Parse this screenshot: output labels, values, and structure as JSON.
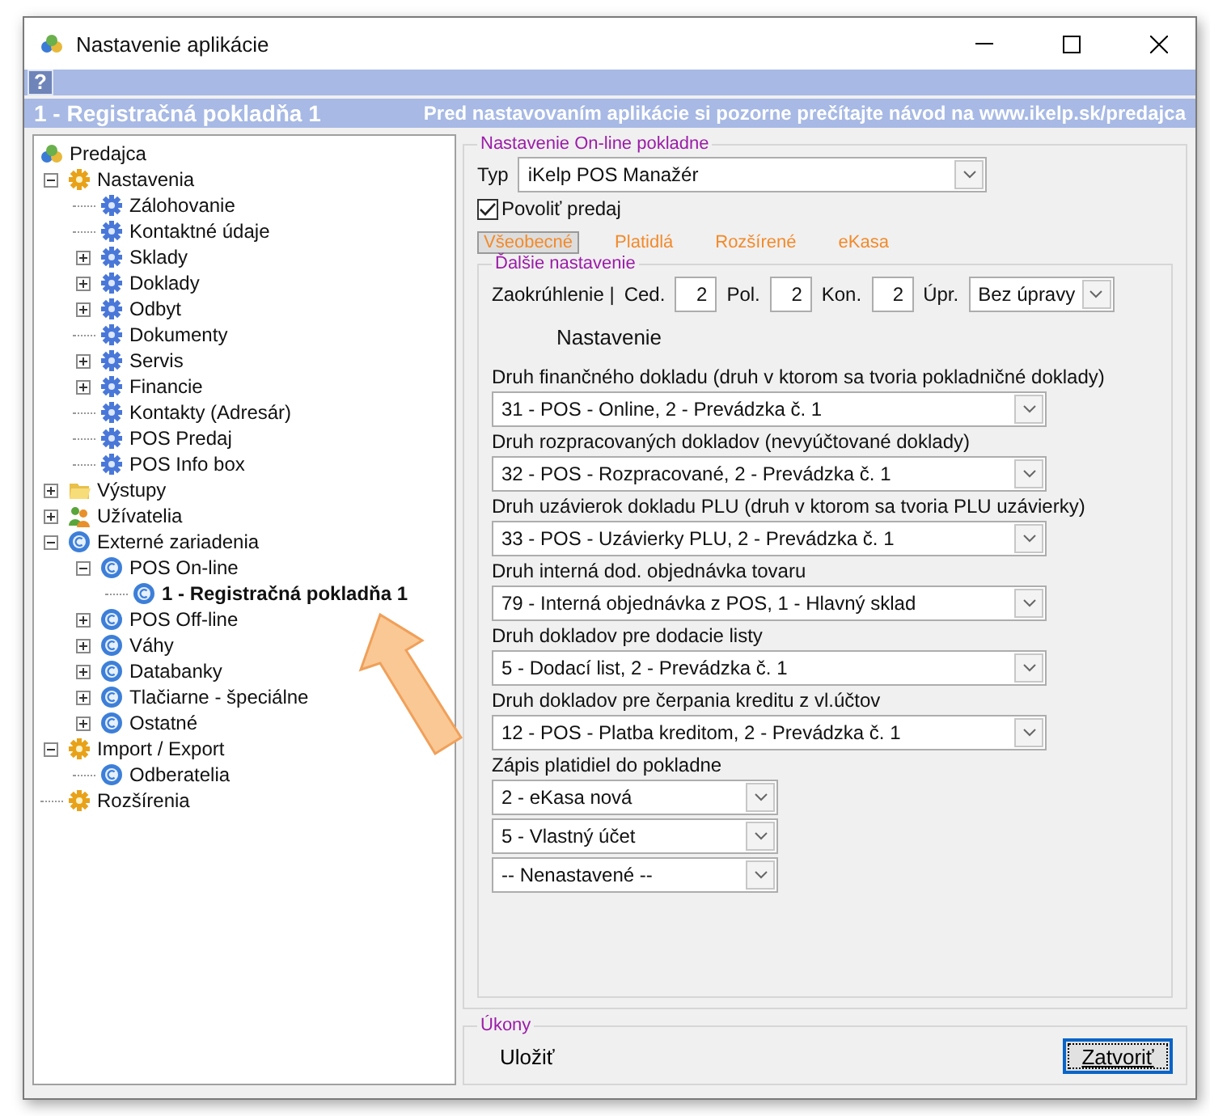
{
  "window": {
    "title": "Nastavenie aplikácie"
  },
  "help_button": "?",
  "header": {
    "title": "1 - Registračná pokladňa 1",
    "notice": "Pred nastavovaním aplikácie si pozorne prečítajte návod na www.ikelp.sk/predajca"
  },
  "tree": [
    {
      "label": "Predajca",
      "kind": "app",
      "selected": false,
      "children": [
        {
          "label": "Nastavenia",
          "kind": "gear-orange",
          "expanded": true,
          "selected": false,
          "children": [
            {
              "label": "Zálohovanie",
              "kind": "gear-blue",
              "selected": false
            },
            {
              "label": "Kontaktné údaje",
              "kind": "gear-blue",
              "selected": false
            },
            {
              "label": "Sklady",
              "kind": "gear-blue",
              "expanded": false,
              "selected": false
            },
            {
              "label": "Doklady",
              "kind": "gear-blue",
              "expanded": false,
              "selected": false
            },
            {
              "label": "Odbyt",
              "kind": "gear-blue",
              "expanded": false,
              "selected": false
            },
            {
              "label": "Dokumenty",
              "kind": "gear-blue",
              "selected": false
            },
            {
              "label": "Servis",
              "kind": "gear-blue",
              "expanded": false,
              "selected": false
            },
            {
              "label": "Financie",
              "kind": "gear-blue",
              "expanded": false,
              "selected": false
            },
            {
              "label": "Kontakty (Adresár)",
              "kind": "gear-blue",
              "selected": false
            },
            {
              "label": "POS Predaj",
              "kind": "gear-blue",
              "selected": false
            },
            {
              "label": "POS Info box",
              "kind": "gear-blue",
              "selected": false
            }
          ]
        },
        {
          "label": "Výstupy",
          "kind": "folder",
          "expanded": false,
          "selected": false
        },
        {
          "label": "Užívatelia",
          "kind": "users",
          "expanded": false,
          "selected": false
        },
        {
          "label": "Externé zariadenia",
          "kind": "euro",
          "expanded": true,
          "selected": false,
          "children": [
            {
              "label": "POS On-line",
              "kind": "euro",
              "expanded": true,
              "selected": false,
              "children": [
                {
                  "label": "1 - Registračná pokladňa 1",
                  "kind": "euro",
                  "selected": true
                }
              ]
            },
            {
              "label": "POS Off-line",
              "kind": "euro",
              "expanded": false,
              "selected": false
            },
            {
              "label": "Váhy",
              "kind": "euro",
              "expanded": false,
              "selected": false
            },
            {
              "label": "Databanky",
              "kind": "euro",
              "expanded": false,
              "selected": false
            },
            {
              "label": "Tlačiarne - špeciálne",
              "kind": "euro",
              "expanded": false,
              "selected": false
            },
            {
              "label": "Ostatné",
              "kind": "euro",
              "expanded": false,
              "selected": false
            }
          ]
        },
        {
          "label": "Import / Export",
          "kind": "gear-orange",
          "expanded": true,
          "selected": false,
          "children": [
            {
              "label": "Odberatelia",
              "kind": "euro",
              "selected": false
            }
          ]
        },
        {
          "label": "Rozšírenia",
          "kind": "gear-orange",
          "selected": false
        }
      ]
    }
  ],
  "settings": {
    "legend": "Nastavenie On-line pokladne",
    "type_label": "Typ",
    "type_value": "iKelp POS Manažér",
    "enable_sale": {
      "label": "Povoliť predaj",
      "checked": true
    },
    "tabs": [
      {
        "label": "Všeobecné",
        "selected": true
      },
      {
        "label": "Platidlá",
        "selected": false
      },
      {
        "label": "Rozšírené",
        "selected": false
      },
      {
        "label": "eKasa",
        "selected": false
      }
    ],
    "more": {
      "legend": "Ďalšie nastavenie",
      "rounding": {
        "label": "Zaokrúhlenie |",
        "fields": [
          {
            "label": "Ced.",
            "value": "2"
          },
          {
            "label": "Pol.",
            "value": "2"
          },
          {
            "label": "Kon.",
            "value": "2"
          }
        ],
        "adjust_label": "Úpr.",
        "adjust_value": "Bez úpravy"
      },
      "section_title": "Nastavenie",
      "document_types": [
        {
          "label": "Druh finančného dokladu (druh v ktorom sa tvoria pokladničné doklady)",
          "value": "31 - POS - Online, 2 - Prevádzka č. 1"
        },
        {
          "label": "Druh rozpracovaných dokladov (nevyúčtované doklady)",
          "value": "32 - POS - Rozpracované, 2 - Prevádzka č. 1"
        },
        {
          "label": "Druh uzávierok dokladu PLU (druh v ktorom sa tvoria PLU uzávierky)",
          "value": "33 - POS - Uzávierky PLU, 2 - Prevádzka č. 1"
        },
        {
          "label": "Druh interná dod. objednávka tovaru",
          "value": "79 - Interná objednávka z POS, 1 - Hlavný sklad"
        },
        {
          "label": "Druh dokladov pre dodacie listy",
          "value": "5 - Dodací list, 2 - Prevádzka č. 1"
        },
        {
          "label": "Druh dokladov pre čerpania kreditu z vl.účtov",
          "value": "12 - POS - Platba kreditom, 2 - Prevádzka č. 1"
        }
      ],
      "payments": {
        "label": "Zápis platidiel do pokladne",
        "values": [
          "2 - eKasa nová",
          "5 - Vlastný účet",
          "-- Nenastavené --"
        ]
      }
    }
  },
  "actions": {
    "legend": "Úkony",
    "save": "Uložiť",
    "close": "Zatvoriť"
  }
}
